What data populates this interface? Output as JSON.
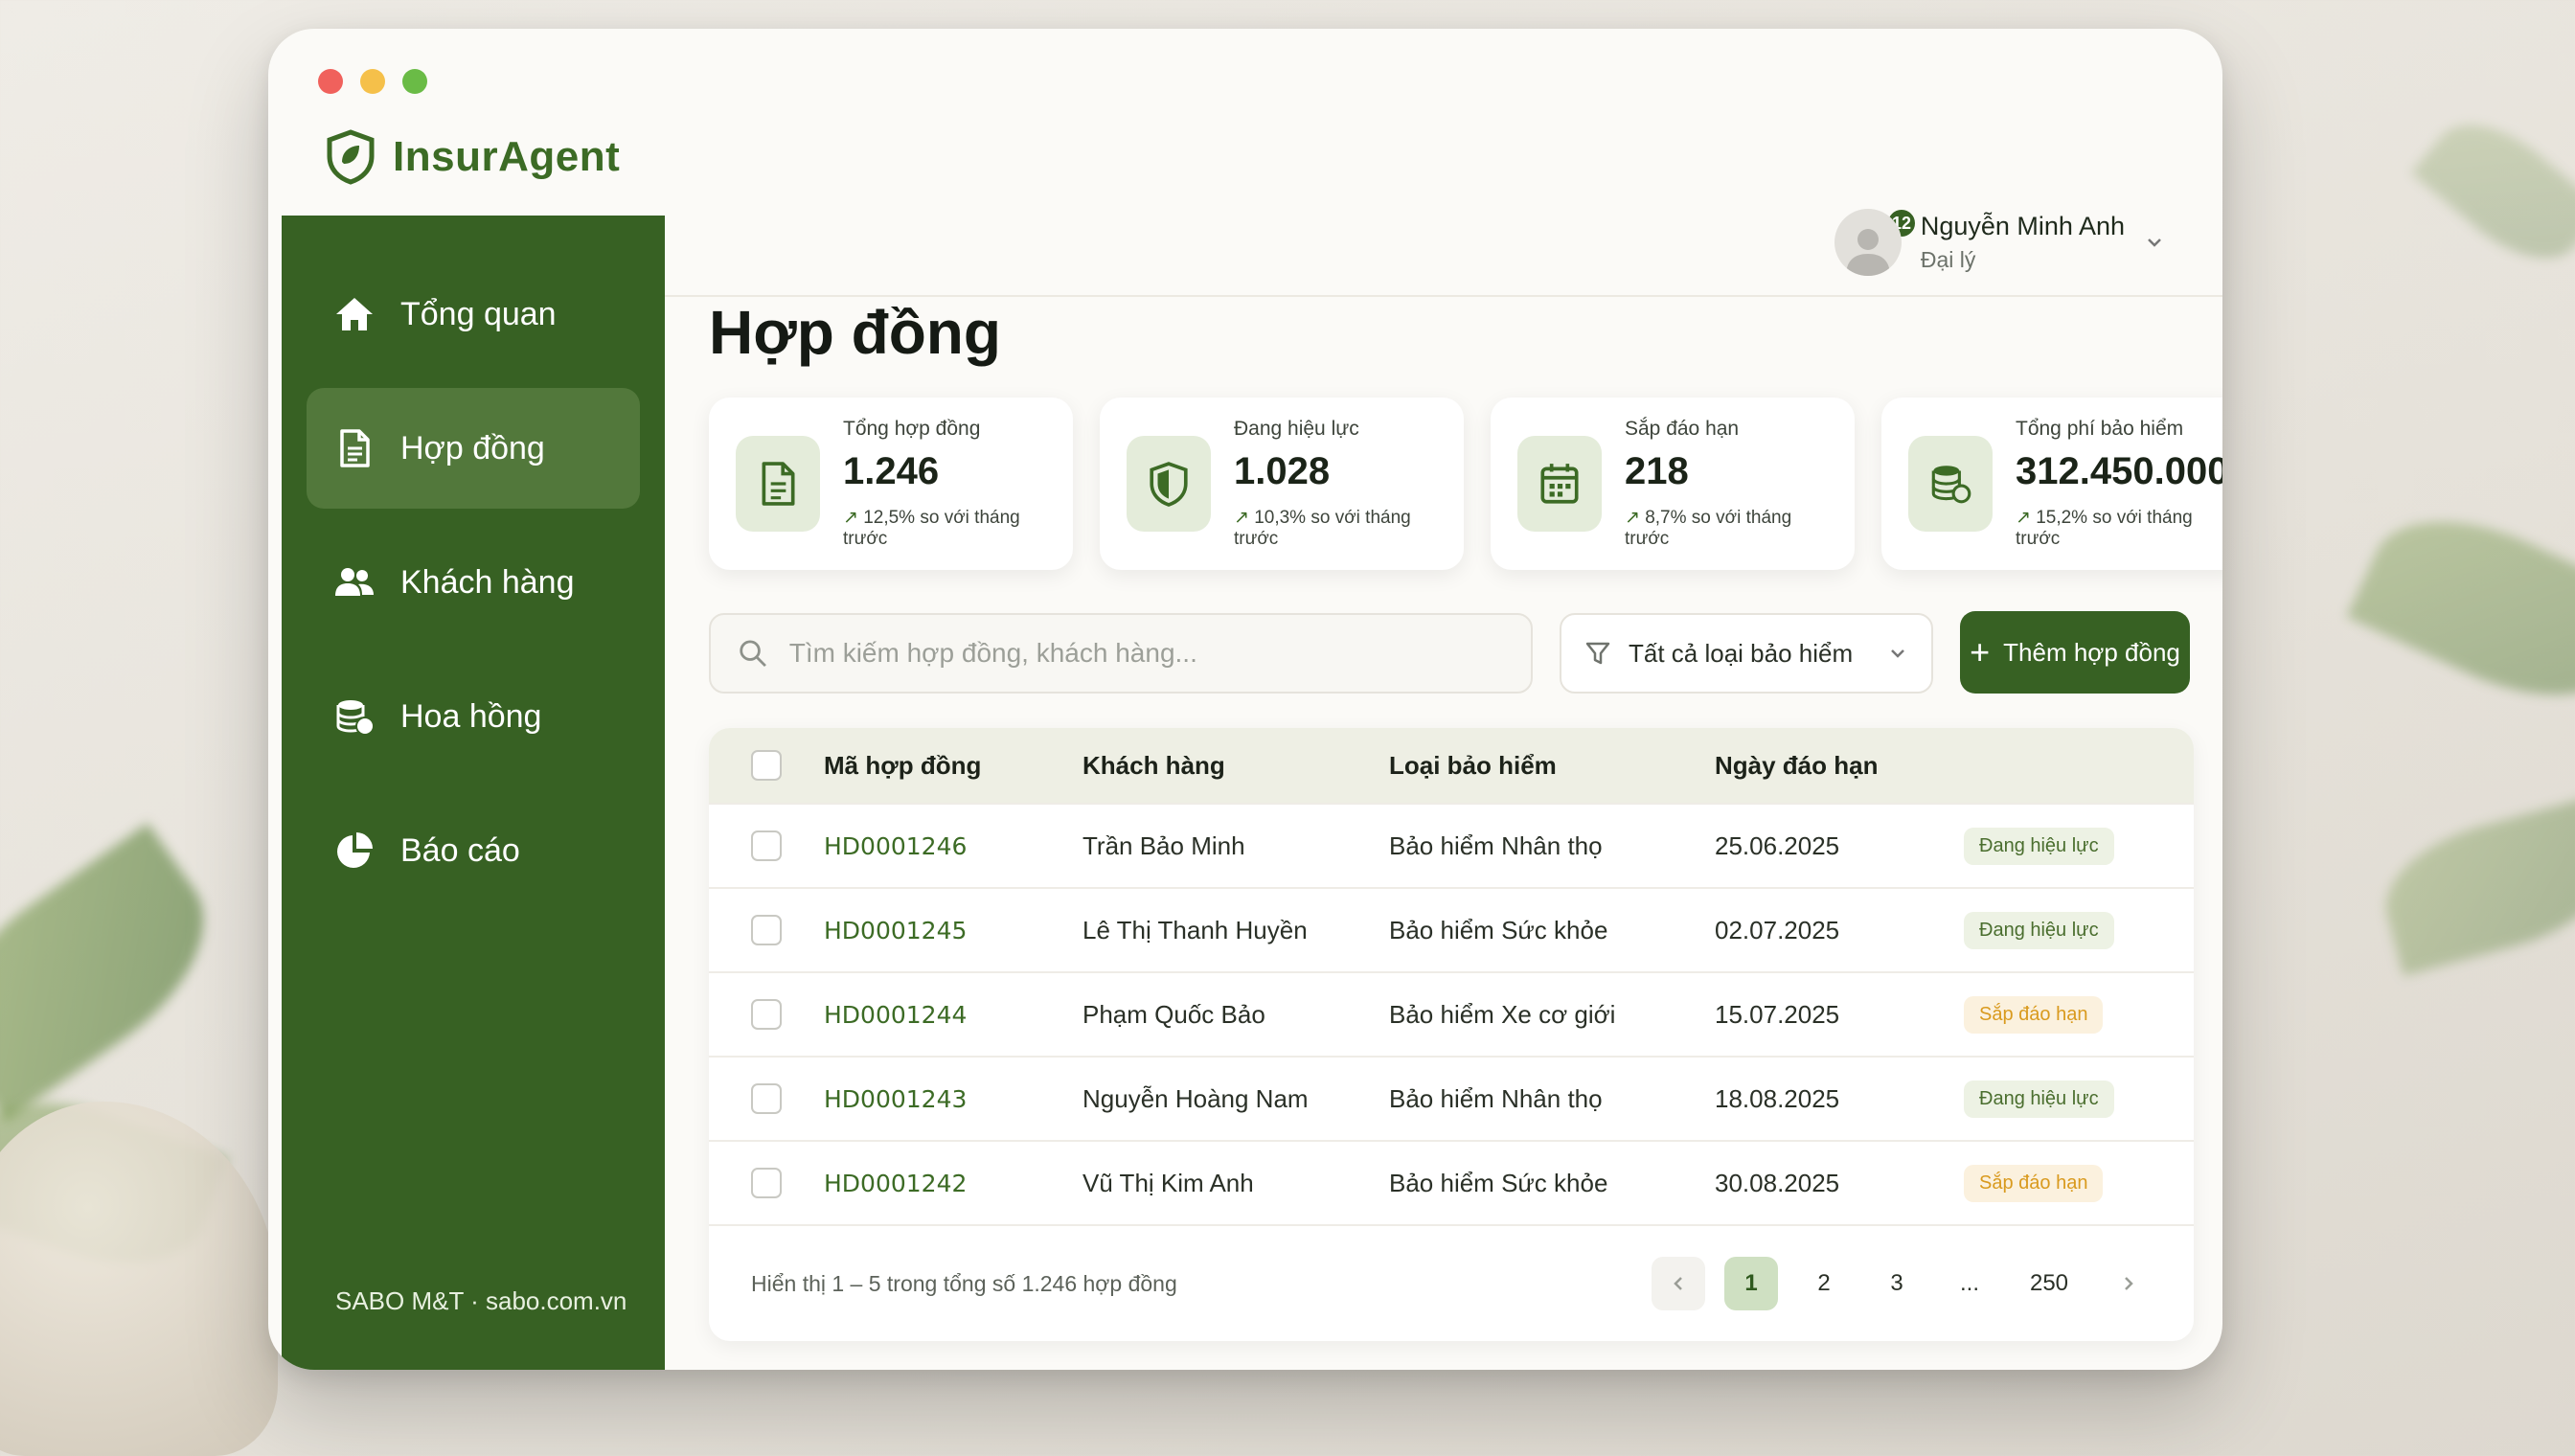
{
  "app": {
    "name": "InsurAgent"
  },
  "sidebar": {
    "items": [
      {
        "label": "Tổng quan",
        "icon": "home-icon"
      },
      {
        "label": "Hợp đồng",
        "icon": "document-icon",
        "active": true
      },
      {
        "label": "Khách hàng",
        "icon": "users-icon"
      },
      {
        "label": "Hoa hồng",
        "icon": "coins-icon"
      },
      {
        "label": "Báo cáo",
        "icon": "pie-chart-icon"
      }
    ],
    "footer": "SABO M&T · sabo.com.vn"
  },
  "header": {
    "notification_count": "12",
    "user": {
      "name": "Nguyễn Minh Anh",
      "role": "Đại lý"
    }
  },
  "page": {
    "title": "Hợp đồng"
  },
  "stats": [
    {
      "label": "Tổng hợp đồng",
      "value": "1.246",
      "change": "12,5% so với tháng trước",
      "icon": "document-icon"
    },
    {
      "label": "Đang hiệu lực",
      "value": "1.028",
      "change": "10,3% so với tháng trước",
      "icon": "shield-icon"
    },
    {
      "label": "Sắp đáo hạn",
      "value": "218",
      "change": "8,7% so với tháng trước",
      "icon": "calendar-icon"
    },
    {
      "label": "Tổng phí bảo hiểm",
      "value": "312.450.000",
      "change": "15,2% so với tháng trước",
      "icon": "coins-icon"
    }
  ],
  "toolbar": {
    "search_placeholder": "Tìm kiếm hợp đồng, khách hàng...",
    "filter_value": "Tất cả loại bảo hiểm",
    "add_label": "Thêm hợp đồng"
  },
  "table": {
    "columns": [
      "Mã hợp đồng",
      "Khách hàng",
      "Loại bảo hiểm",
      "Ngày đáo hạn"
    ],
    "rows": [
      {
        "code": "HD0001246",
        "customer": "Trần Bảo Minh",
        "type": "Bảo hiểm Nhân thọ",
        "due": "25.06.2025",
        "status": "Đang hiệu lực",
        "status_kind": "ok"
      },
      {
        "code": "HD0001245",
        "customer": "Lê Thị Thanh Huyền",
        "type": "Bảo hiểm Sức khỏe",
        "due": "02.07.2025",
        "status": "Đang hiệu lực",
        "status_kind": "ok"
      },
      {
        "code": "HD0001244",
        "customer": "Phạm Quốc Bảo",
        "type": "Bảo hiểm Xe cơ giới",
        "due": "15.07.2025",
        "status": "Sắp đáo hạn",
        "status_kind": "warn"
      },
      {
        "code": "HD0001243",
        "customer": "Nguyễn Hoàng Nam",
        "type": "Bảo hiểm Nhân thọ",
        "due": "18.08.2025",
        "status": "Đang hiệu lực",
        "status_kind": "ok"
      },
      {
        "code": "HD0001242",
        "customer": "Vũ Thị Kim Anh",
        "type": "Bảo hiểm Sức khỏe",
        "due": "30.08.2025",
        "status": "Sắp đáo hạn",
        "status_kind": "warn"
      }
    ],
    "footer_text": "Hiển thị 1 – 5 trong tổng số 1.246 hợp đồng",
    "pagination": {
      "pages": [
        "1",
        "2",
        "3",
        "...",
        "250"
      ],
      "current": "1"
    }
  },
  "colors": {
    "brand": "#376123",
    "accent": "#3c6b25",
    "warning": "#d99a1e"
  }
}
